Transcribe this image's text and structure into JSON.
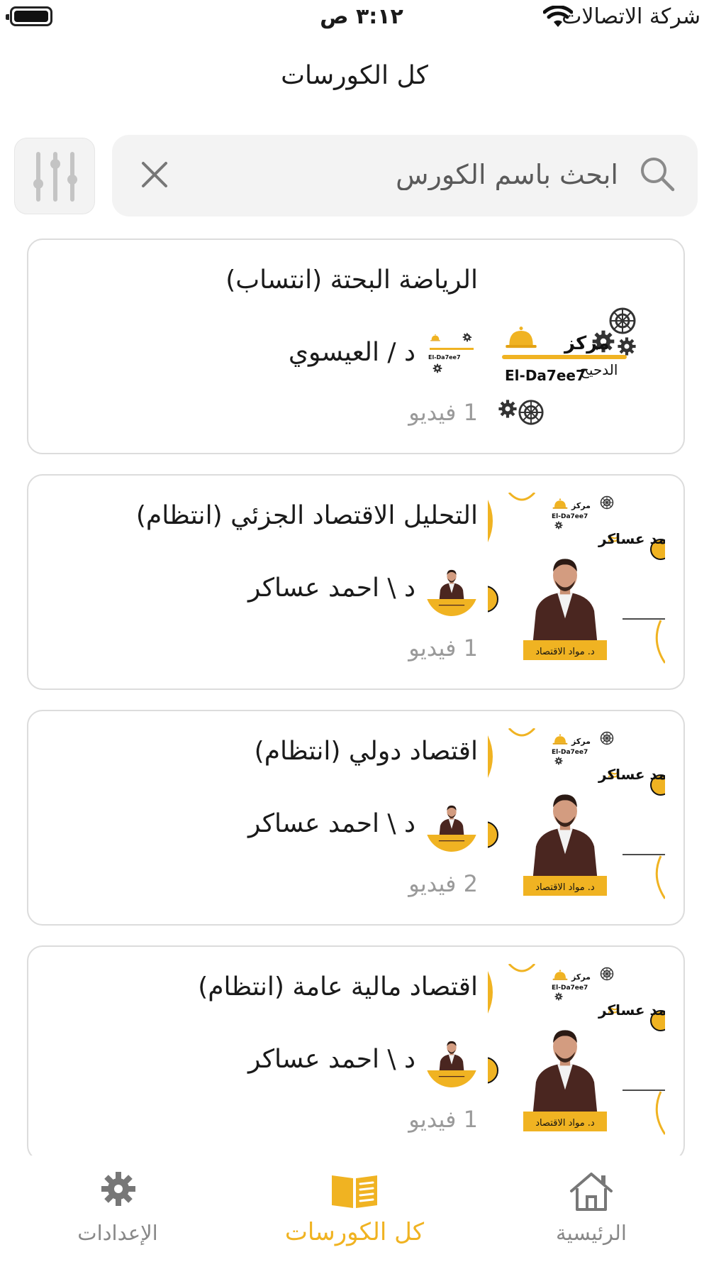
{
  "status_bar": {
    "carrier": "شركة الاتصالات",
    "time": "٣:١٢ ص",
    "battery_level": 1.0
  },
  "page_title": "كل الكورسات",
  "search": {
    "placeholder": "ابحث باسم الكورس",
    "value": ""
  },
  "courses": [
    {
      "title": "الرياضة البحتة (انتساب)",
      "instructor": "د /  العيسوي",
      "videos": "1 فيديو",
      "thumbnail": "center-logo"
    },
    {
      "title": "التحليل الاقتصاد الجزئي (انتظام)",
      "instructor": "د \\ احمد عساكر",
      "videos": "1 فيديو",
      "thumbnail": "instructor-poster"
    },
    {
      "title": "اقتصاد دولي (انتظام)",
      "instructor": "د \\ احمد عساكر",
      "videos": "2 فيديو",
      "thumbnail": "instructor-poster"
    },
    {
      "title": "اقتصاد مالية عامة (انتظام)",
      "instructor": "د \\ احمد عساكر",
      "videos": "1 فيديو",
      "thumbnail": "instructor-poster"
    }
  ],
  "logo": {
    "center_word": "مركز",
    "center_name_ar": "الدحيح",
    "center_name_en": "El-Da7ee7"
  },
  "poster": {
    "doctor_name": "د. احمد عساكر",
    "banner": "د. مواد الاقتصاد"
  },
  "bottom_nav": [
    {
      "label": "الإعدادات",
      "icon": "gear-icon",
      "active": false
    },
    {
      "label": "كل الكورسات",
      "icon": "book-icon",
      "active": true
    },
    {
      "label": "الرئيسية",
      "icon": "home-icon",
      "active": false
    }
  ],
  "colors": {
    "accent": "#f0b322",
    "inactive": "#888888",
    "card_border": "#dcdcdc",
    "search_bg": "#f3f3f3"
  }
}
